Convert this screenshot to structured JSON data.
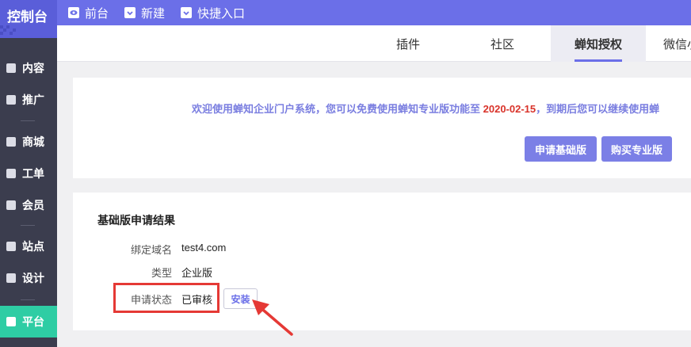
{
  "brand": {
    "title": "控制台"
  },
  "topnav": [
    {
      "label": "前台",
      "icon": "eye-icon"
    },
    {
      "label": "新建",
      "icon": "plus-square-icon"
    },
    {
      "label": "快捷入口",
      "icon": "chevron-down-icon"
    }
  ],
  "sidebar": {
    "items": [
      {
        "label": "内容",
        "icon": "document-icon"
      },
      {
        "label": "推广",
        "icon": "megaphone-icon"
      },
      {
        "label": "商城",
        "icon": "shopping-bag-icon"
      },
      {
        "label": "工单",
        "icon": "clipboard-icon"
      },
      {
        "label": "会员",
        "icon": "diamond-icon"
      },
      {
        "label": "站点",
        "icon": "location-pin-icon"
      },
      {
        "label": "设计",
        "icon": "design-icon"
      },
      {
        "label": "平台",
        "icon": "platform-icon",
        "active": true
      }
    ]
  },
  "tabs": [
    {
      "label": "插件"
    },
    {
      "label": "社区"
    },
    {
      "label": "蝉知授权",
      "active": true
    },
    {
      "label": "微信小"
    }
  ],
  "notice": {
    "prefix": "欢迎使用蝉知企业门户系统，您可以免费使用蝉知专业版功能至 ",
    "date": "2020-02-15",
    "suffix": "，到期后您可以继续使用蝉"
  },
  "buttons": {
    "apply_basic": "申请基础版",
    "buy_pro": "购买专业版"
  },
  "result": {
    "title": "基础版申请结果",
    "rows": [
      {
        "label": "绑定域名",
        "value": "test4.com"
      },
      {
        "label": "类型",
        "value": "企业版"
      },
      {
        "label": "申请状态",
        "value": "已审核"
      }
    ],
    "install_label": "安装"
  },
  "colors": {
    "accent": "#6b6fe8",
    "sidebar_bg": "#3b3d4e",
    "active_sidebar": "#2ecda4",
    "highlight": "#e53935",
    "date": "#d9332a"
  }
}
